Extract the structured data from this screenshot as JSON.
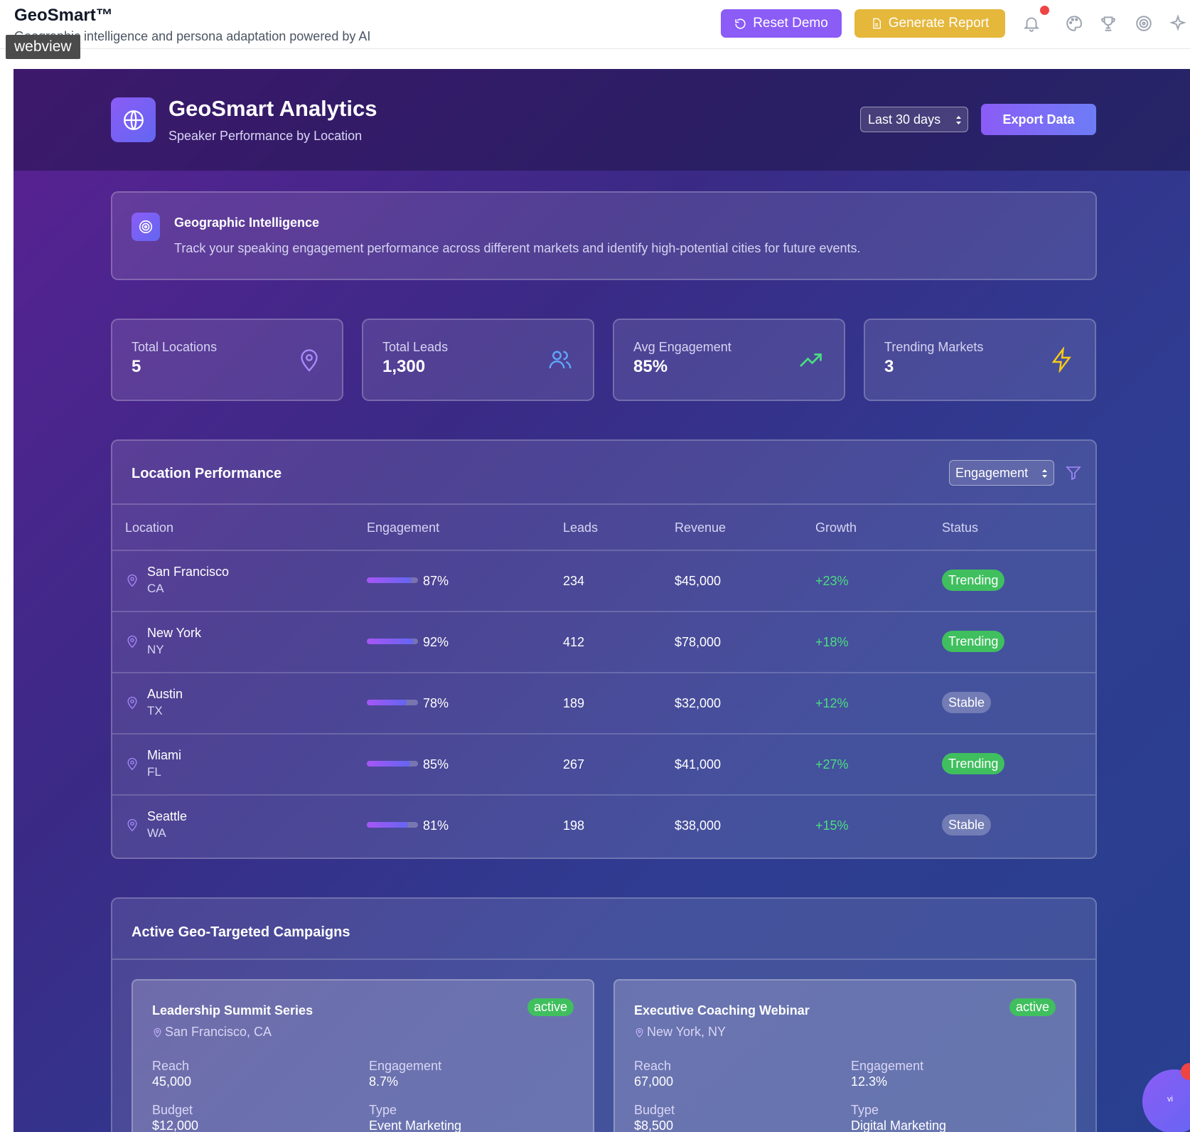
{
  "app": {
    "title": "GeoSmart™",
    "subtitle": "Geographic intelligence and persona adaptation powered by AI",
    "webview_tag": "webview"
  },
  "topbar": {
    "reset_label": "Reset Demo",
    "report_label": "Generate Report",
    "icons": [
      "bell-icon",
      "palette-icon",
      "trophy-icon",
      "target-icon",
      "sparkle-icon"
    ]
  },
  "header": {
    "title": "GeoSmart Analytics",
    "subtitle": "Speaker Performance by Location",
    "range_value": "Last 30 days",
    "export_label": "Export Data"
  },
  "info": {
    "title": "Geographic Intelligence",
    "text": "Track your speaking engagement performance across different markets and identify high-potential cities for future events."
  },
  "stats": [
    {
      "label": "Total Locations",
      "value": "5",
      "icon": "map-pin-icon"
    },
    {
      "label": "Total Leads",
      "value": "1,300",
      "icon": "users-icon"
    },
    {
      "label": "Avg Engagement",
      "value": "85%",
      "icon": "trending-up-icon"
    },
    {
      "label": "Trending Markets",
      "value": "3",
      "icon": "lightning-icon"
    }
  ],
  "table": {
    "title": "Location Performance",
    "sort_value": "Engagement",
    "headers": [
      "Location",
      "Engagement",
      "Leads",
      "Revenue",
      "Growth",
      "Status"
    ],
    "rows": [
      {
        "city": "San Francisco",
        "state": "CA",
        "engagement": "87%",
        "engagement_value": 87,
        "leads": "234",
        "revenue": "$45,000",
        "growth": "+23%",
        "status": "Trending"
      },
      {
        "city": "New York",
        "state": "NY",
        "engagement": "92%",
        "engagement_value": 92,
        "leads": "412",
        "revenue": "$78,000",
        "growth": "+18%",
        "status": "Trending"
      },
      {
        "city": "Austin",
        "state": "TX",
        "engagement": "78%",
        "engagement_value": 78,
        "leads": "189",
        "revenue": "$32,000",
        "growth": "+12%",
        "status": "Stable"
      },
      {
        "city": "Miami",
        "state": "FL",
        "engagement": "85%",
        "engagement_value": 85,
        "leads": "267",
        "revenue": "$41,000",
        "growth": "+27%",
        "status": "Trending"
      },
      {
        "city": "Seattle",
        "state": "WA",
        "engagement": "81%",
        "engagement_value": 81,
        "leads": "198",
        "revenue": "$38,000",
        "growth": "+15%",
        "status": "Stable"
      }
    ]
  },
  "campaigns": {
    "title": "Active Geo-Targeted Campaigns",
    "items": [
      {
        "name": "Leadership Summit Series",
        "badge": "active",
        "location": "San Francisco, CA",
        "reach_label": "Reach",
        "reach": "45,000",
        "engagement_label": "Engagement",
        "engagement": "8.7%",
        "budget_label": "Budget",
        "budget": "$12,000",
        "type_label": "Type",
        "type": "Event Marketing"
      },
      {
        "name": "Executive Coaching Webinar",
        "badge": "active",
        "location": "New York, NY",
        "reach_label": "Reach",
        "reach": "67,000",
        "engagement_label": "Engagement",
        "engagement": "12.3%",
        "budget_label": "Budget",
        "budget": "$8,500",
        "type_label": "Type",
        "type": "Digital Marketing"
      }
    ]
  },
  "chat": {
    "avatar_text": "vi"
  },
  "colors": {
    "accent": "#8b5cf6",
    "report": "#e5b73b",
    "trending": "#3fbf5e",
    "growth": "#4ade80",
    "alert": "#ef4444"
  }
}
